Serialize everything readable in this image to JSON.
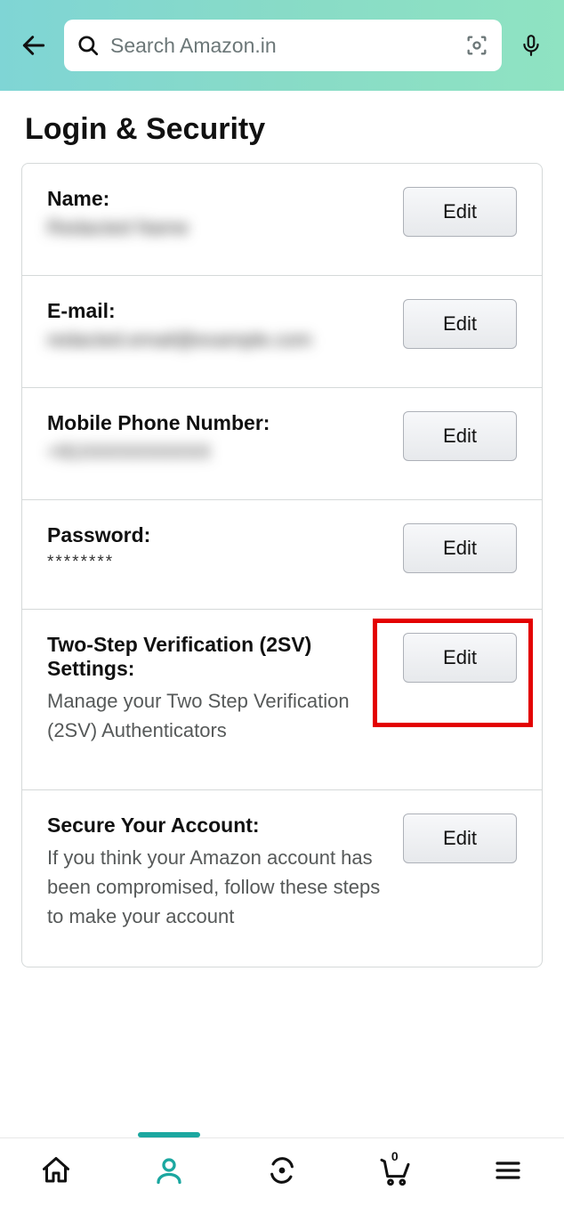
{
  "header": {
    "search_placeholder": "Search Amazon.in"
  },
  "page": {
    "title": "Login & Security"
  },
  "settings": [
    {
      "label": "Name:",
      "value": "Redacted Name",
      "description": "",
      "edit_label": "Edit",
      "blur": true
    },
    {
      "label": "E-mail:",
      "value": "redacted.email@example.com",
      "description": "",
      "edit_label": "Edit",
      "blur": true
    },
    {
      "label": "Mobile Phone Number:",
      "value": "+91XXXXXXXXXX",
      "description": "",
      "edit_label": "Edit",
      "blur": true
    },
    {
      "label": "Password:",
      "value": "********",
      "description": "",
      "edit_label": "Edit",
      "blur": false
    },
    {
      "label": "Two-Step Verification (2SV) Settings:",
      "value": "",
      "description": "Manage your Two Step Verification (2SV) Authenticators",
      "edit_label": "Edit",
      "highlighted": true
    },
    {
      "label": "Secure Your Account:",
      "value": "",
      "description": "If you think your Amazon account has been compromised, follow these steps to make your account",
      "edit_label": "Edit"
    }
  ],
  "bottom_nav": {
    "cart_count": "0"
  }
}
